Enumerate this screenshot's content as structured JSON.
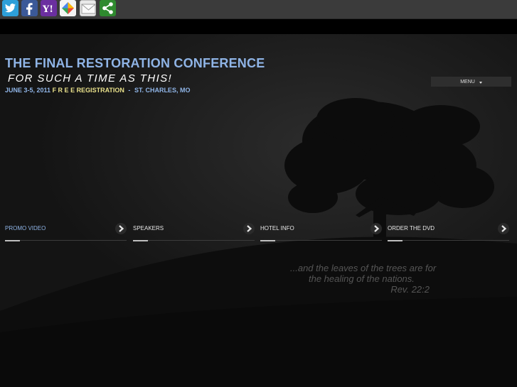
{
  "share_bar": {
    "buttons": [
      {
        "name": "twitter",
        "icon": "twitter-bird-icon",
        "color": "#2d9fd9"
      },
      {
        "name": "facebook",
        "icon": "facebook-f-icon",
        "color": "#3b5998"
      },
      {
        "name": "yahoo",
        "icon": "yahoo-logo-icon",
        "color": "#6b2fa0"
      },
      {
        "name": "google",
        "icon": "google-bookmark-icon",
        "color": "#f4f4f4"
      },
      {
        "name": "email",
        "icon": "envelope-icon",
        "color": "#e9e9e9"
      },
      {
        "name": "share",
        "icon": "share-icon",
        "color": "#2f8a2f"
      }
    ]
  },
  "header": {
    "title": "THE FINAL RESTORATION CONFERENCE",
    "subtitle": "FOR SUCH A TIME AS THIS!",
    "date": "JUNE 3-5, 2011",
    "registration": "F R E E REGISTRATION",
    "separator": "-",
    "location": "ST. CHARLES, MO"
  },
  "menu": {
    "label": "MENU",
    "icon": "caret-down-icon"
  },
  "nav": [
    {
      "label": "PROMO VIDEO",
      "active": true
    },
    {
      "label": "SPEAKERS",
      "active": false
    },
    {
      "label": "HOTEL INFO",
      "active": false
    },
    {
      "label": "ORDER THE DVD",
      "active": false
    }
  ],
  "verse": {
    "line1": "...and the leaves of the trees are for",
    "line2": "the healing of the nations.",
    "reference": "Rev. 22:2"
  },
  "colors": {
    "title_blue": "#8fb4e6",
    "registration_yellow": "#e8e08a",
    "background": "#1c1c1c"
  }
}
